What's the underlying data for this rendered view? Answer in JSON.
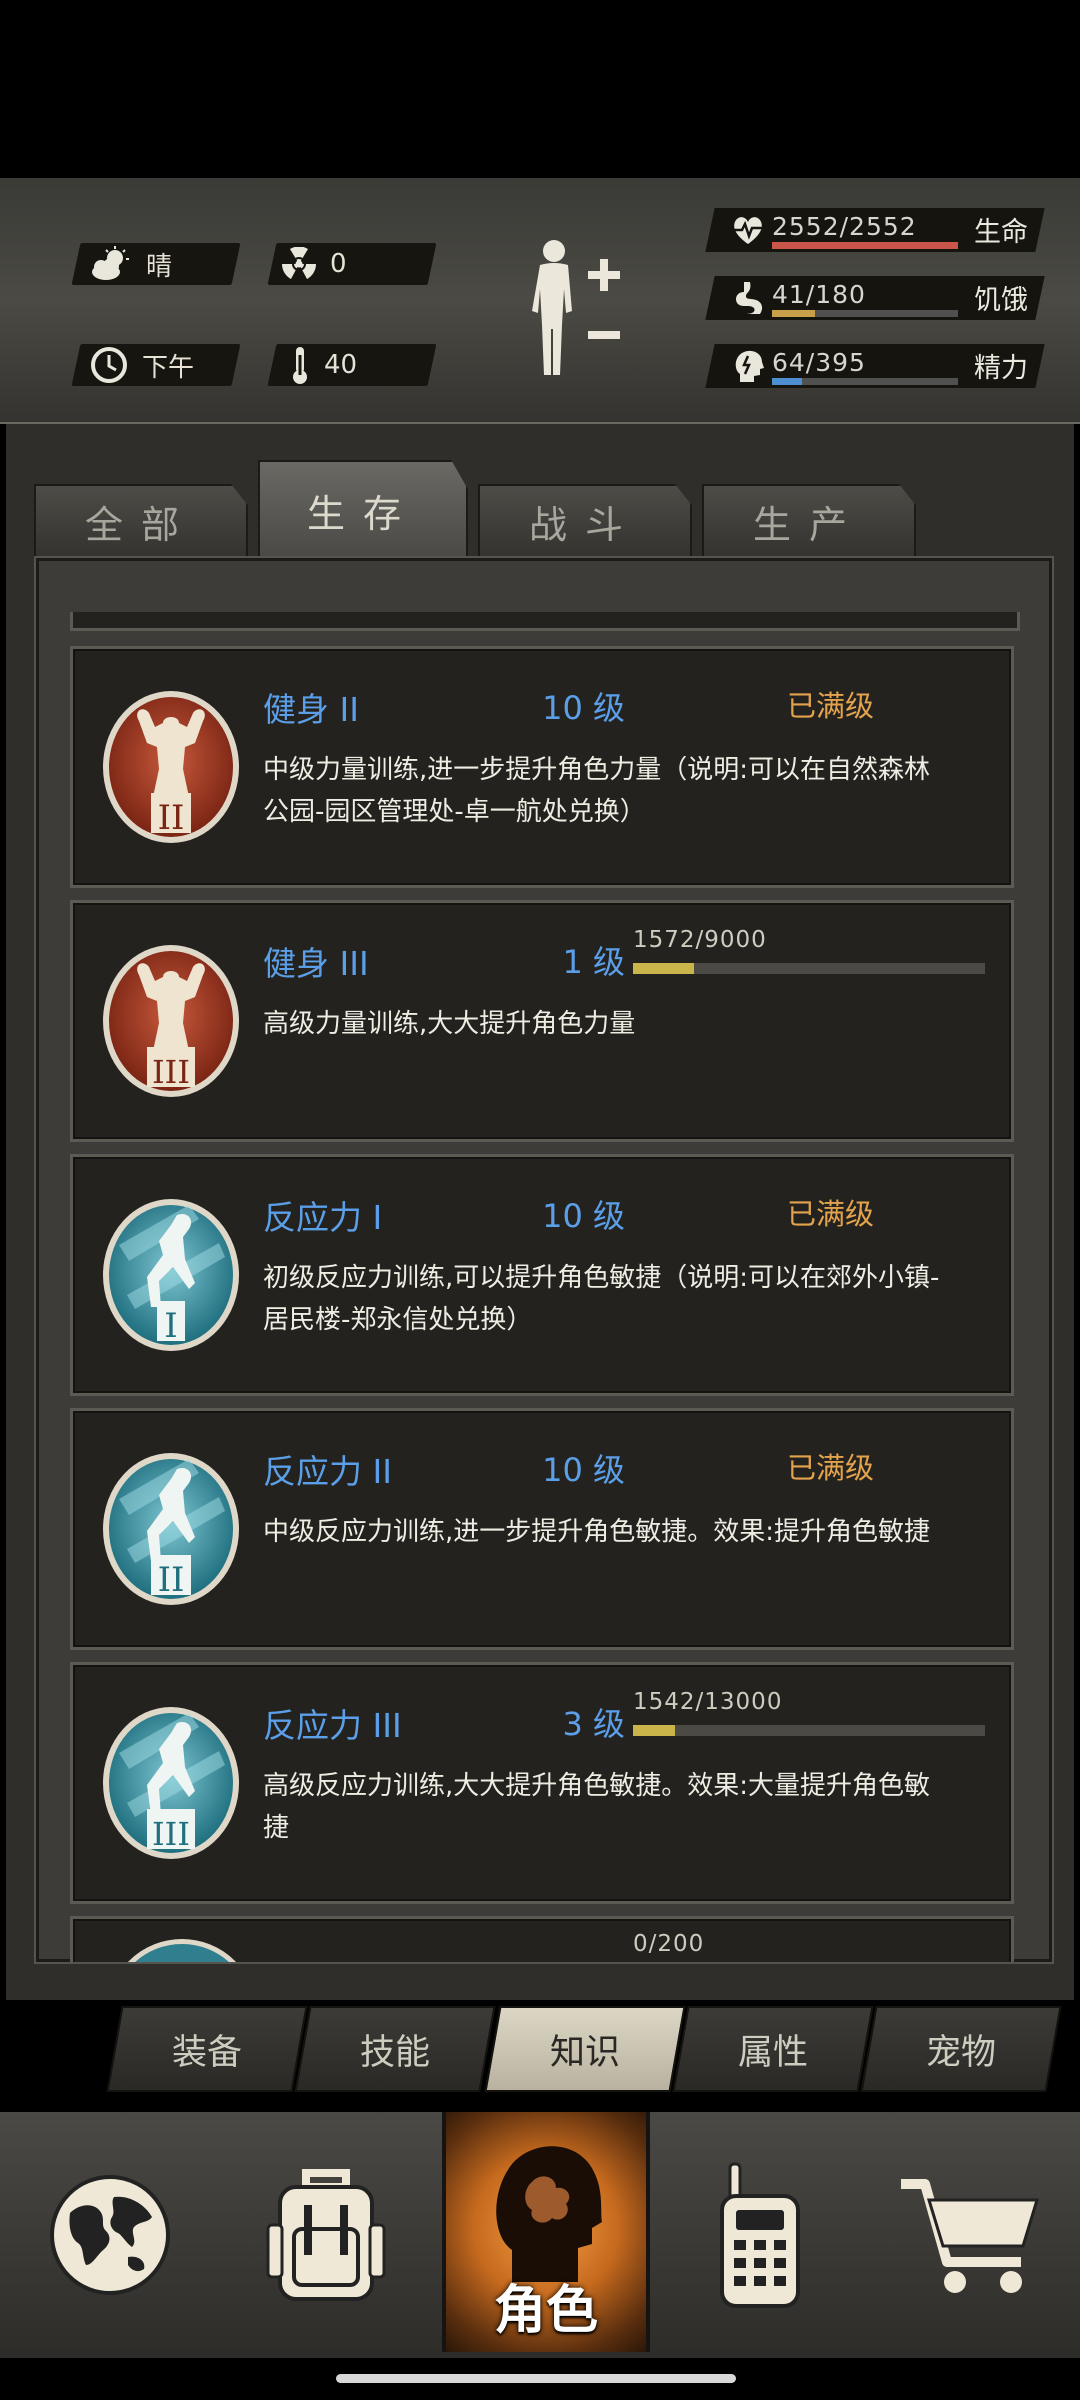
{
  "status": {
    "weather": {
      "icon": "cloud-sun-icon",
      "label": "晴"
    },
    "radiation": {
      "icon": "radiation-icon",
      "value": "0"
    },
    "time": {
      "icon": "clock-icon",
      "label": "下午"
    },
    "temperature": {
      "icon": "thermometer-icon",
      "value": "40"
    },
    "body_icon": "body-figure-icon",
    "stats": [
      {
        "key": "health",
        "icon": "heart-pulse-icon",
        "value": "2552/2552",
        "label": "生命",
        "fraction": 1.0,
        "color": "#c9554b"
      },
      {
        "key": "hunger",
        "icon": "stomach-icon",
        "value": "41/180",
        "label": "饥饿",
        "fraction": 0.23,
        "color": "#c8a04a"
      },
      {
        "key": "energy",
        "icon": "brain-head-icon",
        "value": "64/395",
        "label": "精力",
        "fraction": 0.16,
        "color": "#4d8fd0"
      }
    ]
  },
  "tabs": [
    {
      "label": "全部",
      "active": false
    },
    {
      "label": "生存",
      "active": true
    },
    {
      "label": "战斗",
      "active": false
    },
    {
      "label": "生产",
      "active": false
    }
  ],
  "skills": [
    {
      "name": "健身 II",
      "level": "10 级",
      "status": "已满级",
      "desc": "中级力量训练,进一步提升角色力量（说明:可以在自然森林公园-园区管理处-卓一航处兑换）",
      "icon": "muscle-icon",
      "tier": "II",
      "theme": "red"
    },
    {
      "name": "健身 III",
      "level": "1 级",
      "progress": "1572/9000",
      "fraction": 0.1747,
      "desc": "高级力量训练,大大提升角色力量",
      "icon": "muscle-icon",
      "tier": "III",
      "theme": "red"
    },
    {
      "name": "反应力 I",
      "level": "10 级",
      "status": "已满级",
      "desc": "初级反应力训练,可以提升角色敏捷（说明:可以在郊外小镇-居民楼-郑永信处兑换）",
      "icon": "agility-icon",
      "tier": "I",
      "theme": "teal"
    },
    {
      "name": "反应力 II",
      "level": "10 级",
      "status": "已满级",
      "desc": "中级反应力训练,进一步提升角色敏捷。效果:提升角色敏捷",
      "icon": "agility-icon",
      "tier": "II",
      "theme": "teal"
    },
    {
      "name": "反应力 III",
      "level": "3 级",
      "progress": "1542/13000",
      "fraction": 0.1186,
      "desc": "高级反应力训练,大大提升角色敏捷。效果:大量提升角色敏捷",
      "icon": "agility-icon",
      "tier": "III",
      "theme": "teal"
    }
  ],
  "partial_next": {
    "progress": "0/200"
  },
  "subtabs": [
    {
      "label": "装备",
      "active": false
    },
    {
      "label": "技能",
      "active": false
    },
    {
      "label": "知识",
      "active": true
    },
    {
      "label": "属性",
      "active": false
    },
    {
      "label": "宠物",
      "active": false
    }
  ],
  "bottom_nav": [
    {
      "icon": "globe-icon",
      "label": ""
    },
    {
      "icon": "backpack-icon",
      "label": ""
    },
    {
      "icon": "character-head-icon",
      "label": "角色",
      "active": true
    },
    {
      "icon": "radio-phone-icon",
      "label": ""
    },
    {
      "icon": "shopping-cart-icon",
      "label": ""
    }
  ]
}
